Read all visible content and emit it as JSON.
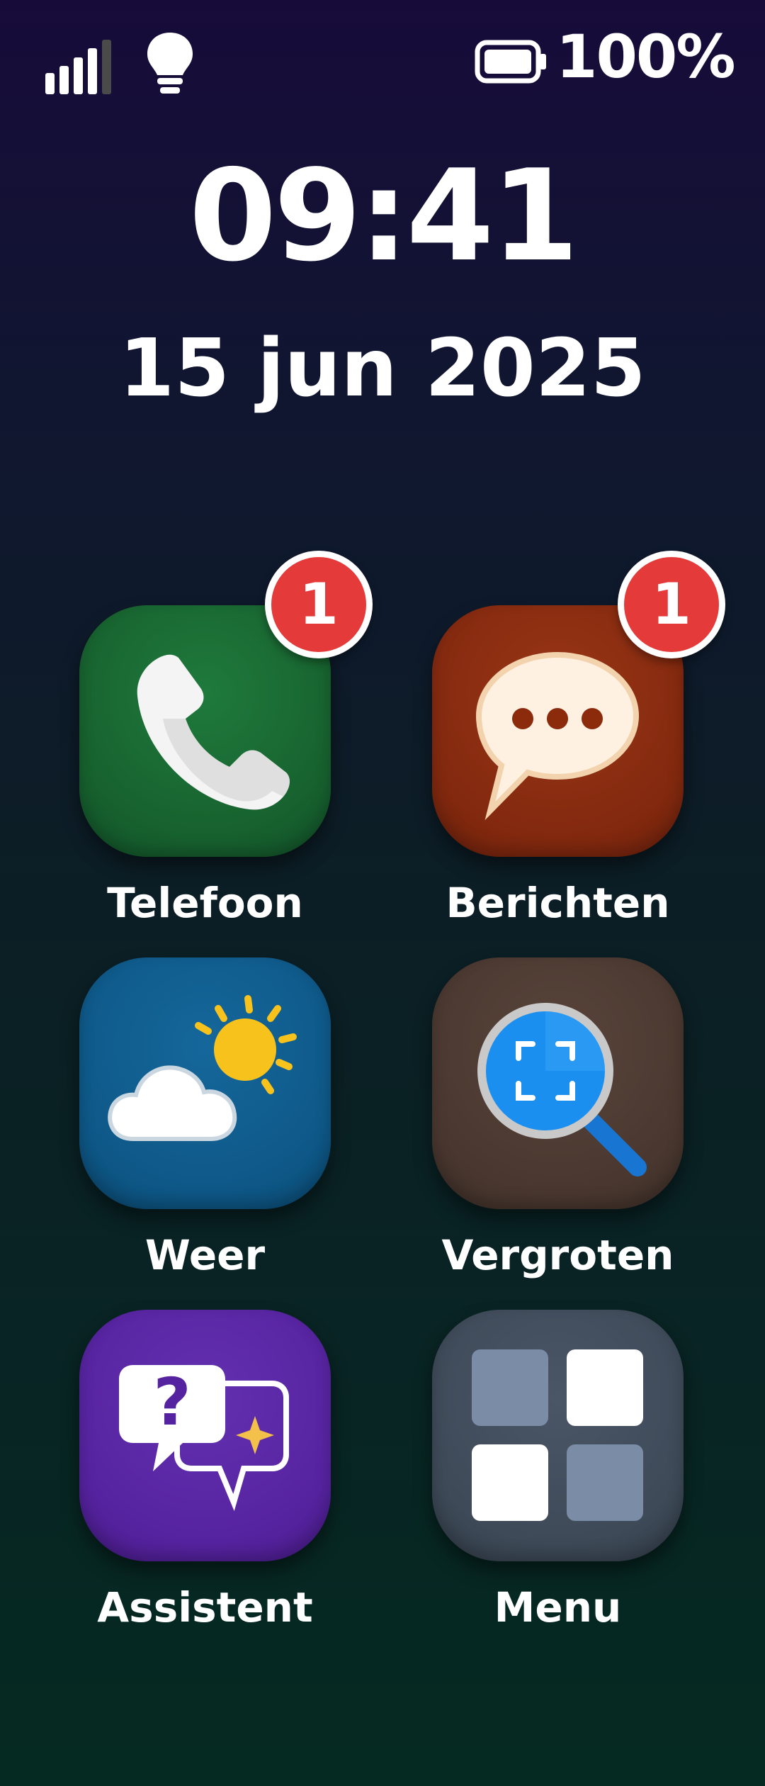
{
  "status_bar": {
    "signal_icon": "signal-bars-icon",
    "flashlight_icon": "lightbulb-icon",
    "battery_icon": "battery-icon",
    "battery_text": "100%",
    "battery_level": 1.0
  },
  "clock": {
    "time": "09:41",
    "date": "15 jun 2025"
  },
  "apps": [
    {
      "label": "Telefoon",
      "icon": "phone-icon",
      "badge": "1",
      "color": "#1a6b35"
    },
    {
      "label": "Berichten",
      "icon": "chat-bubble-icon",
      "badge": "1",
      "color": "#8a2d10"
    },
    {
      "label": "Weer",
      "icon": "weather-icon",
      "color": "#0e5888"
    },
    {
      "label": "Vergroten",
      "icon": "magnifier-icon",
      "color": "#4e3a32"
    },
    {
      "label": "Assistent",
      "icon": "assistant-icon",
      "color": "#5623a0"
    },
    {
      "label": "Menu",
      "icon": "grid-menu-icon",
      "color": "#3e4a58"
    }
  ]
}
